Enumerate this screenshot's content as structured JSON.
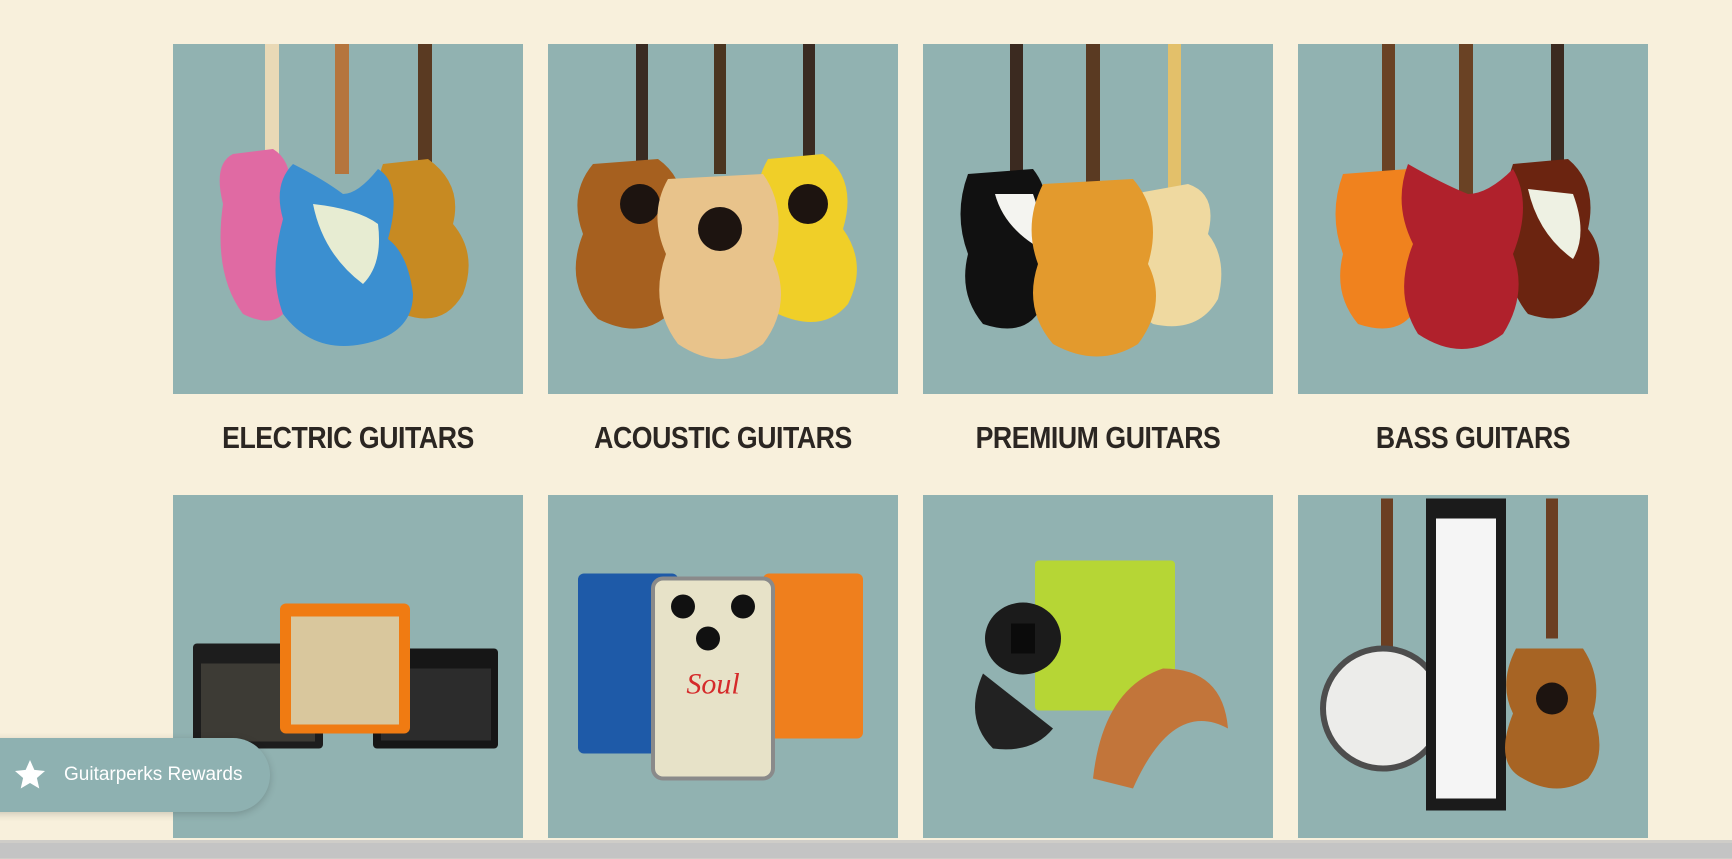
{
  "categories_row1": [
    {
      "label": "ELECTRIC GUITARS"
    },
    {
      "label": "ACOUSTIC GUITARS"
    },
    {
      "label": "PREMIUM GUITARS"
    },
    {
      "label": "BASS GUITARS"
    }
  ],
  "categories_row2": [
    {
      "image": "amplifiers"
    },
    {
      "image": "effects pedals"
    },
    {
      "image": "accessories"
    },
    {
      "image": "folk instruments"
    }
  ],
  "rewards": {
    "label": "Guitarperks Rewards",
    "icon": "star-icon"
  },
  "colors": {
    "page_bg": "#f8f0dc",
    "tile_bg": "#91b2b1",
    "label_text": "#2b2622",
    "rewards_bg": "#8eb1b1"
  }
}
